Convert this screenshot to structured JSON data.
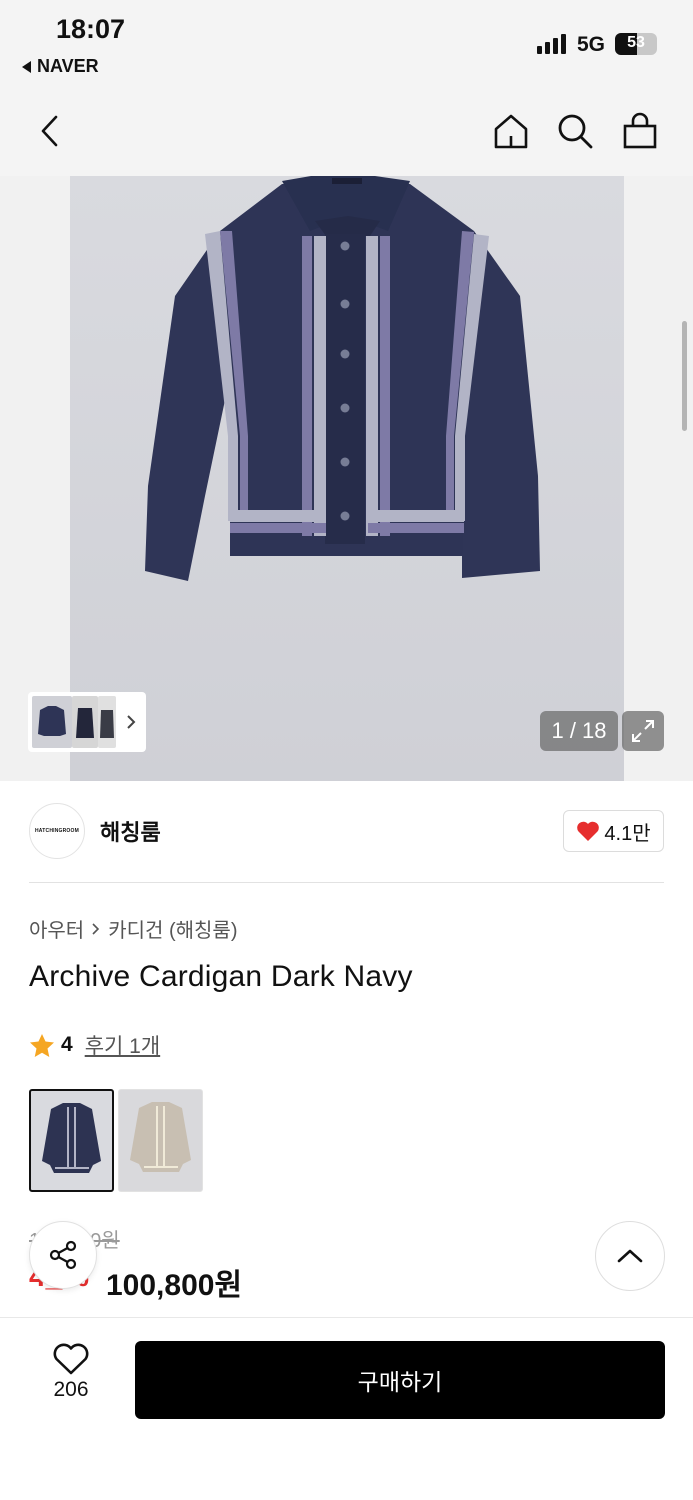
{
  "status_bar": {
    "time": "18:07",
    "back_app": "NAVER",
    "network": "5G",
    "battery": "53",
    "battery_level": 0.53
  },
  "nav": {
    "back_icon": "chevron-left-icon",
    "home_icon": "home-icon",
    "search_icon": "search-icon",
    "cart_icon": "shopping-bag-icon"
  },
  "gallery": {
    "counter": "1 / 18",
    "current_index": 1,
    "total_images": 18,
    "thumbnail_more_icon": "chevron-right-icon",
    "expand_icon": "expand-icon"
  },
  "brand": {
    "logo_text": "HATCHINGROOM",
    "name": "해칭룸",
    "likes": "4.1만"
  },
  "breadcrumb": {
    "category": "아우터",
    "subcategory": "카디건 (해칭룸)"
  },
  "product": {
    "title": "Archive Cardigan Dark Navy",
    "rating": "4",
    "reviews": "후기 1개",
    "colors": [
      "navy",
      "beige"
    ],
    "original_price": "1__,_00원",
    "discount": "4_%",
    "price": "100,800원"
  },
  "bottom_bar": {
    "wish_count": "206",
    "buy_label": "구매하기"
  },
  "colors": {
    "accent_red": "#e62e2e",
    "buy_button": "#000000",
    "navy": "#2d3352"
  }
}
